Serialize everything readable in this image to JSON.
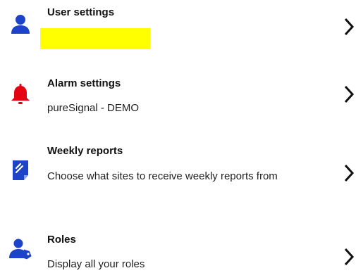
{
  "settings_list": {
    "items": [
      {
        "id": "user-settings",
        "icon": "person-icon",
        "title": "User settings",
        "subtitle": "",
        "icon_color": "#1d43c9"
      },
      {
        "id": "alarm-settings",
        "icon": "bell-icon",
        "title": "Alarm settings",
        "subtitle": "pureSignal - DEMO",
        "icon_color": "#e50012"
      },
      {
        "id": "weekly-reports",
        "icon": "report-icon",
        "title": "Weekly reports",
        "subtitle": "Choose what sites to receive weekly reports from",
        "icon_color": "#1d43c9"
      },
      {
        "id": "roles",
        "icon": "person-tag-icon",
        "title": "Roles",
        "subtitle": "Display all your roles",
        "icon_color": "#1d43c9"
      }
    ]
  },
  "colors": {
    "highlight": "#ffff00",
    "chevron": "#111111"
  }
}
